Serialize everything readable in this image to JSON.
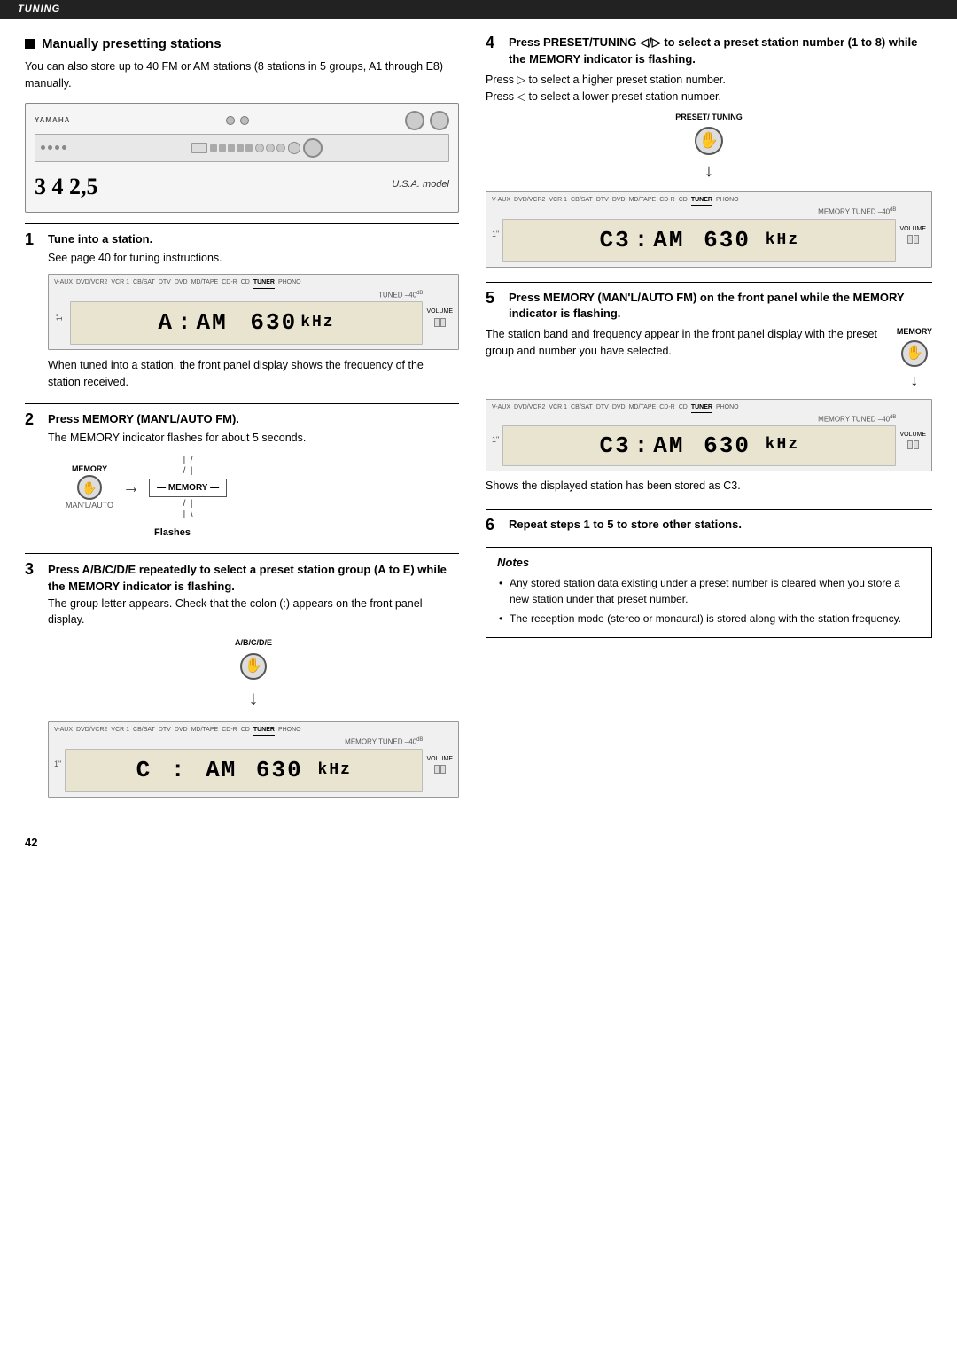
{
  "topbar": {
    "label": "TUNING"
  },
  "left": {
    "section_title": "Manually presetting stations",
    "section_intro": "You can also store up to 40 FM or AM stations (8 stations in 5 groups, A1 through E8) manually.",
    "receiver_model": "U.S.A. model",
    "number_labels": "3 4   2,5",
    "step1": {
      "num": "1",
      "title": "Tune into a station.",
      "body": "See page 40 for tuning instructions.",
      "display_text": "A : AM  630 kHz"
    },
    "step1_caption": "When tuned into a station, the front panel display shows the frequency of the station received.",
    "step2": {
      "num": "2",
      "title": "Press MEMORY (MAN'L/AUTO FM).",
      "body": "The MEMORY indicator flashes for about 5 seconds.",
      "flashes_label": "Flashes"
    },
    "step3": {
      "num": "3",
      "title_part1": "Press A/B/C/D/E repeatedly to select a preset station group (A to E) while the MEMORY indicator is flashing.",
      "body1": "The group letter appears. Check that the colon (:) appears on the front panel display.",
      "display_text": "C : AM  630 kHz",
      "abcde_label": "A/B/C/D/E"
    }
  },
  "right": {
    "step4": {
      "num": "4",
      "title": "Press PRESET/TUNING ◁/▷ to select a preset station number (1 to 8) while the MEMORY indicator is flashing.",
      "body1": "Press ▷ to select a higher preset station number.",
      "body2": "Press ◁ to select a lower preset station number.",
      "display_text": "C3: AM  630 kHz",
      "preset_tuning_label": "PRESET/ TUNING"
    },
    "step5": {
      "num": "5",
      "title": "Press MEMORY (MAN'L/AUTO FM) on the front panel while the MEMORY indicator is flashing.",
      "body": "The station band and frequency appear in the front panel display with the preset group and number you have selected.",
      "display_text": "C3: AM  630 kHz",
      "memory_label": "MEMORY",
      "caption": "Shows the displayed station has been stored as C3."
    },
    "step6": {
      "num": "6",
      "title": "Repeat steps 1 to 5 to store other stations."
    },
    "notes_title": "Notes",
    "notes": [
      "Any stored station data existing under a preset number is cleared when you store a new station under that preset number.",
      "The reception mode (stereo or monaural) is stored along with the station frequency."
    ]
  },
  "footer": {
    "page_number": "42"
  },
  "lcd_labels": {
    "vaux": "V-AUX",
    "dvdvcr2": "DVD/VCR2",
    "vcr1": "VCR 1",
    "cbsat": "CB/SAT",
    "dtv": "DTV",
    "dvd": "DVD",
    "mdtape": "MD/TAPE",
    "cdr": "CD-R",
    "cd": "CD",
    "tuner": "TUNER",
    "phono": "PHONO",
    "tuned": "TUNED",
    "volume": "VOLUME",
    "memory_tuned": "MEMORY TUNED"
  }
}
